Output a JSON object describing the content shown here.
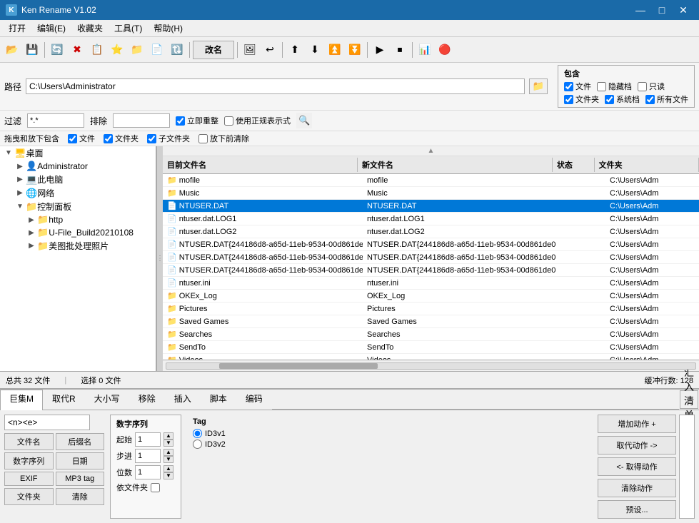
{
  "titlebar": {
    "title": "Ken Rename V1.02",
    "icon": "K",
    "min_btn": "—",
    "max_btn": "□",
    "close_btn": "✕"
  },
  "menubar": {
    "items": [
      {
        "label": "打开"
      },
      {
        "label": "编辑(E)"
      },
      {
        "label": "收藏夹"
      },
      {
        "label": "工具(T)"
      },
      {
        "label": "帮助(H)"
      }
    ]
  },
  "toolbar": {
    "rename_btn": "改名"
  },
  "pathbar": {
    "label": "路径",
    "value": "C:\\Users\\Administrator"
  },
  "filter": {
    "label": "过滤",
    "value": "*.*",
    "exclude_label": "排除",
    "exclude_value": "",
    "instant_reset": "立即重整",
    "use_regex": "使用正规表示式"
  },
  "include": {
    "title": "包含",
    "options": [
      {
        "label": "文件",
        "checked": true
      },
      {
        "label": "隐藏档",
        "checked": false
      },
      {
        "label": "只读",
        "checked": false
      },
      {
        "label": "文件夹",
        "checked": true
      },
      {
        "label": "系统档",
        "checked": true
      },
      {
        "label": "所有文件",
        "checked": true
      }
    ]
  },
  "dragdrop": {
    "label": "拖曳和放下包含",
    "file_cb": "文件",
    "folder_cb": "文件夹",
    "subfolder_cb": "子文件夹",
    "clear_cb": "放下前清除"
  },
  "tree": {
    "items": [
      {
        "label": "桌面",
        "level": 1,
        "icon": "desktop",
        "expanded": true
      },
      {
        "label": "Administrator",
        "level": 2,
        "icon": "folder",
        "expanded": false
      },
      {
        "label": "此电脑",
        "level": 2,
        "icon": "computer",
        "expanded": false
      },
      {
        "label": "网络",
        "level": 2,
        "icon": "network",
        "expanded": false
      },
      {
        "label": "控制面板",
        "level": 2,
        "icon": "folder",
        "expanded": true
      },
      {
        "label": "http",
        "level": 3,
        "icon": "folder",
        "expanded": false
      },
      {
        "label": "U-File_Build20210108",
        "level": 3,
        "icon": "folder",
        "expanded": false
      },
      {
        "label": "美图批处理照片",
        "level": 3,
        "icon": "folder",
        "expanded": false
      }
    ]
  },
  "filelist": {
    "headers": [
      "目前文件名",
      "新文件名",
      "状态",
      "文件夹"
    ],
    "rows": [
      {
        "name": "mofile",
        "newname": "mofile",
        "status": "",
        "folder": "C:\\Users\\Adm",
        "type": "folder",
        "selected": false
      },
      {
        "name": "Music",
        "newname": "Music",
        "status": "",
        "folder": "C:\\Users\\Adm",
        "type": "folder",
        "selected": false
      },
      {
        "name": "NTUSER.DAT",
        "newname": "NTUSER.DAT",
        "status": "",
        "folder": "C:\\Users\\Adm",
        "type": "file",
        "selected": true
      },
      {
        "name": "ntuser.dat.LOG1",
        "newname": "ntuser.dat.LOG1",
        "status": "",
        "folder": "C:\\Users\\Adm",
        "type": "file",
        "selected": false
      },
      {
        "name": "ntuser.dat.LOG2",
        "newname": "ntuser.dat.LOG2",
        "status": "",
        "folder": "C:\\Users\\Adm",
        "type": "file",
        "selected": false
      },
      {
        "name": "NTUSER.DAT{244186d8-a65d-11eb-9534-00d861de0",
        "newname": "NTUSER.DAT{244186d8-a65d-11eb-9534-00d861de0",
        "status": "",
        "folder": "C:\\Users\\Adm",
        "type": "file",
        "selected": false
      },
      {
        "name": "NTUSER.DAT{244186d8-a65d-11eb-9534-00d861de0",
        "newname": "NTUSER.DAT{244186d8-a65d-11eb-9534-00d861de0",
        "status": "",
        "folder": "C:\\Users\\Adm",
        "type": "file",
        "selected": false
      },
      {
        "name": "NTUSER.DAT{244186d8-a65d-11eb-9534-00d861de0",
        "newname": "NTUSER.DAT{244186d8-a65d-11eb-9534-00d861de0",
        "status": "",
        "folder": "C:\\Users\\Adm",
        "type": "file",
        "selected": false
      },
      {
        "name": "ntuser.ini",
        "newname": "ntuser.ini",
        "status": "",
        "folder": "C:\\Users\\Adm",
        "type": "file",
        "selected": false
      },
      {
        "name": "OKEx_Log",
        "newname": "OKEx_Log",
        "status": "",
        "folder": "C:\\Users\\Adm",
        "type": "folder",
        "selected": false
      },
      {
        "name": "Pictures",
        "newname": "Pictures",
        "status": "",
        "folder": "C:\\Users\\Adm",
        "type": "folder",
        "selected": false
      },
      {
        "name": "Saved Games",
        "newname": "Saved Games",
        "status": "",
        "folder": "C:\\Users\\Adm",
        "type": "folder",
        "selected": false
      },
      {
        "name": "Searches",
        "newname": "Searches",
        "status": "",
        "folder": "C:\\Users\\Adm",
        "type": "folder",
        "selected": false
      },
      {
        "name": "SendTo",
        "newname": "SendTo",
        "status": "",
        "folder": "C:\\Users\\Adm",
        "type": "folder",
        "selected": false
      },
      {
        "name": "Videos",
        "newname": "Videos",
        "status": "",
        "folder": "C:\\Users\\Adm",
        "type": "folder",
        "selected": false
      }
    ]
  },
  "statusbar": {
    "total": "总共 32 文件",
    "selected": "选择 0 文件",
    "buffer": "缓冲行数: 128"
  },
  "bottompanel": {
    "tabs": [
      "巨集M",
      "取代R",
      "大小写",
      "移除",
      "插入",
      "脚本",
      "编码"
    ],
    "import_label": "汇入清单(I)",
    "pattern_value": "<n><e>",
    "action_buttons": [
      "文件名",
      "后缀名",
      "数字序列",
      "日期",
      "EXIF",
      "MP3 tag",
      "文件夹",
      "清除"
    ],
    "numseq": {
      "title": "数字序列",
      "start_label": "起始",
      "start_value": "1",
      "step_label": "步进",
      "step_value": "1",
      "digits_label": "位数",
      "digits_value": "1",
      "folder_label": "依文件夹"
    },
    "tag": {
      "title": "Tag",
      "options": [
        "ID3v1",
        "ID3v2"
      ],
      "selected": "ID3v1"
    },
    "right_buttons": [
      "增加动作 +",
      "取代动作 ->",
      "<- 取得动作",
      "清除动作",
      "预设..."
    ],
    "right_panel_color": "#f0f0f0"
  },
  "colors": {
    "selected_row_bg": "#0078d7",
    "selected_folder_bg": "#0058b0",
    "folder_icon": "#ffc107",
    "toolbar_bg": "#f0f0f0",
    "titlebar_bg": "#1a6aa8"
  }
}
